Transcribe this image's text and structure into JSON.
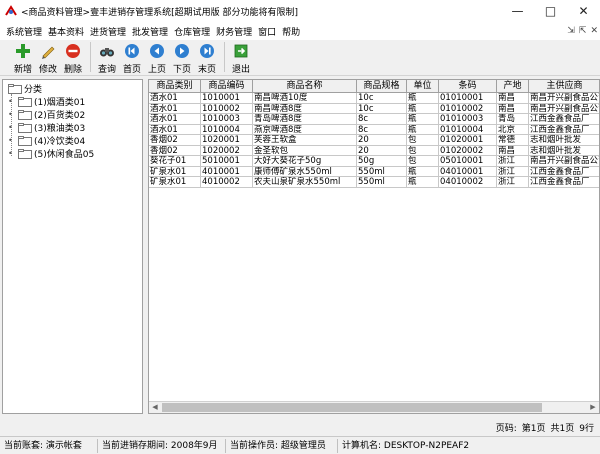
{
  "window": {
    "title": "<商品资料管理>壹丰进销存管理系统[超期试用版 部分功能将有限制]"
  },
  "menu": [
    "系统管理",
    "基本资料",
    "进货管理",
    "批发管理",
    "仓库管理",
    "财务管理",
    "窗口",
    "帮助"
  ],
  "toolbar": {
    "new": "新增",
    "edit": "修改",
    "delete": "删除",
    "query": "查询",
    "first": "首页",
    "prev": "上页",
    "next": "下页",
    "last": "末页",
    "exit": "退出"
  },
  "tree": {
    "root": "分类",
    "items": [
      "(1)烟酒类01",
      "(2)百货类02",
      "(3)粮油类03",
      "(4)冷饮类04",
      "(5)休闲食品05"
    ]
  },
  "grid": {
    "columns": [
      "商品类别",
      "商品编码",
      "商品名称",
      "商品规格",
      "单位",
      "条码",
      "产地",
      "主供应商"
    ],
    "rows": [
      [
        "酒水01",
        "1010001",
        "南昌啤酒10度",
        "10c",
        "瓶",
        "01010001",
        "南昌",
        "南昌开兴副食品公司"
      ],
      [
        "酒水01",
        "1010002",
        "南昌啤酒8度",
        "10c",
        "瓶",
        "01010002",
        "南昌",
        "南昌开兴副食品公司"
      ],
      [
        "酒水01",
        "1010003",
        "青岛啤酒8度",
        "8c",
        "瓶",
        "01010003",
        "青岛",
        "江西金鑫食品厂"
      ],
      [
        "酒水01",
        "1010004",
        "燕京啤酒8度",
        "8c",
        "瓶",
        "01010004",
        "北京",
        "江西金鑫食品厂"
      ],
      [
        "香烟02",
        "1020001",
        "芙蓉王软盒",
        "20",
        "包",
        "01020001",
        "常德",
        "志和烟叶批发"
      ],
      [
        "香烟02",
        "1020002",
        "金圣软包",
        "20",
        "包",
        "01020002",
        "南昌",
        "志和烟叶批发"
      ],
      [
        "葵花子01",
        "5010001",
        "大好大葵花子50g",
        "50g",
        "包",
        "05010001",
        "浙江",
        "南昌开兴副食品公司"
      ],
      [
        "矿泉水01",
        "4010001",
        "康师傅矿泉水550ml",
        "550ml",
        "瓶",
        "04010001",
        "浙江",
        "江西金鑫食品厂"
      ],
      [
        "矿泉水01",
        "4010002",
        "农夫山泉矿泉水550ml",
        "550ml",
        "瓶",
        "04010002",
        "浙江",
        "江西金鑫食品厂"
      ]
    ]
  },
  "pager": {
    "label": "页码:",
    "current": "第1页",
    "total": "共1页",
    "count": "9行"
  },
  "status": {
    "account": "当前账套: 演示帐套",
    "period": "当前进销存期间: 2008年9月",
    "operator": "当前操作员: 超级管理员",
    "computer": "计算机名: DESKTOP-N2PEAF2"
  }
}
